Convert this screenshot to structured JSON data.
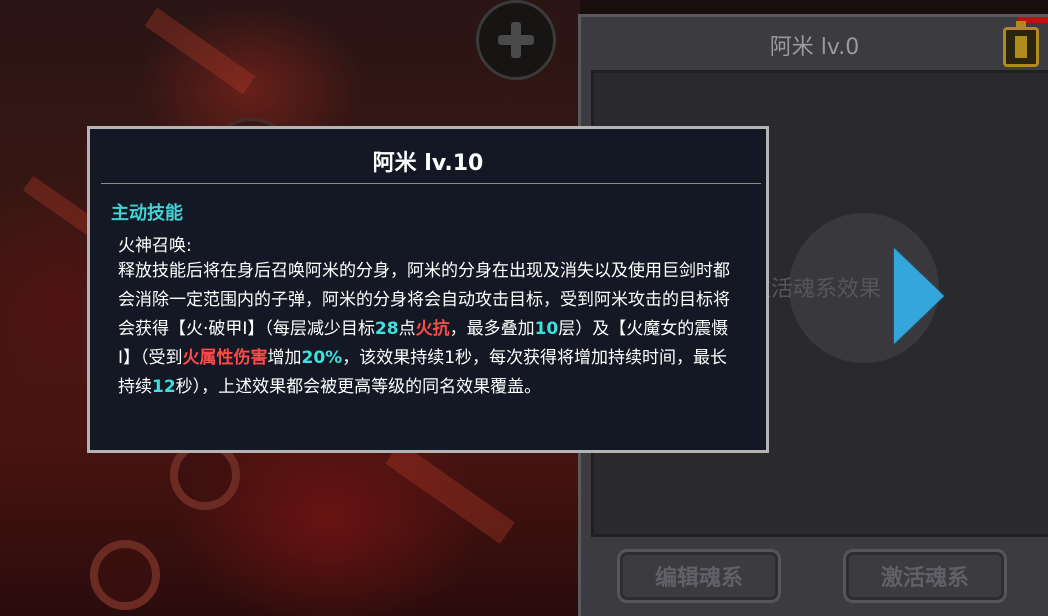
{
  "tooltip": {
    "title": "阿米 lv.10",
    "skill_type": "主动技能",
    "skill_name": "火神召唤:",
    "desc": {
      "p1": "释放技能后将在身后召唤阿米的分身，阿米的分身在出现及消失以及使用巨剑时都会消除一定范围内的子弹，阿米的分身将会自动攻击目标，受到阿米攻击的目标将会获得【火·破甲Ⅰ】（每层减少目标",
      "v1": "28",
      "p2": "点",
      "r1": "火抗",
      "p3": "，最多叠加",
      "v2": "10",
      "p4": "层）及【火魔女的震慑Ⅰ】（受到",
      "r2": "火属性伤害",
      "p5": "增加",
      "v3": "20%",
      "p6": "，该效果持续1秒，每次获得将增加持续时间，最长持续",
      "v4": "12",
      "p7": "秒），上述效果都会被更高等级的同名效果覆盖。"
    }
  },
  "panel": {
    "title": "阿米 lv.0",
    "activate_hint": "激活魂系效果",
    "edit_button": "编辑魂系",
    "activate_button": "激活魂系"
  },
  "colors": {
    "highlight_value": "#3fe0e0",
    "highlight_fire": "#ff4a4a",
    "skill_type": "#3fd4d4",
    "arrow": "#35a6dc"
  },
  "icons": [
    "plus-icon",
    "battery-icon",
    "arrow-right-icon"
  ]
}
